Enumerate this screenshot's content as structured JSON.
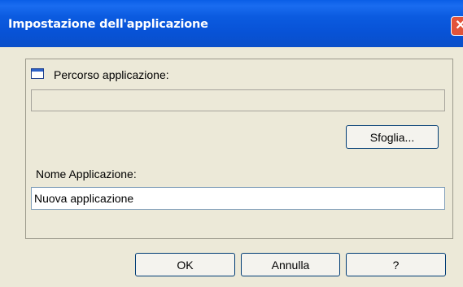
{
  "window": {
    "title": "Impostazione dell'applicazione",
    "close_symbol": "✕"
  },
  "fields": {
    "path_label": "Percorso applicazione:",
    "path_value": "",
    "browse_label": "Sfoglia...",
    "name_label": "Nome Applicazione:",
    "name_value": "Nuova applicazione"
  },
  "buttons": {
    "ok": "OK",
    "cancel": "Annulla",
    "help": "?"
  },
  "icons": {
    "application": "application-window-icon",
    "close": "close-icon"
  }
}
